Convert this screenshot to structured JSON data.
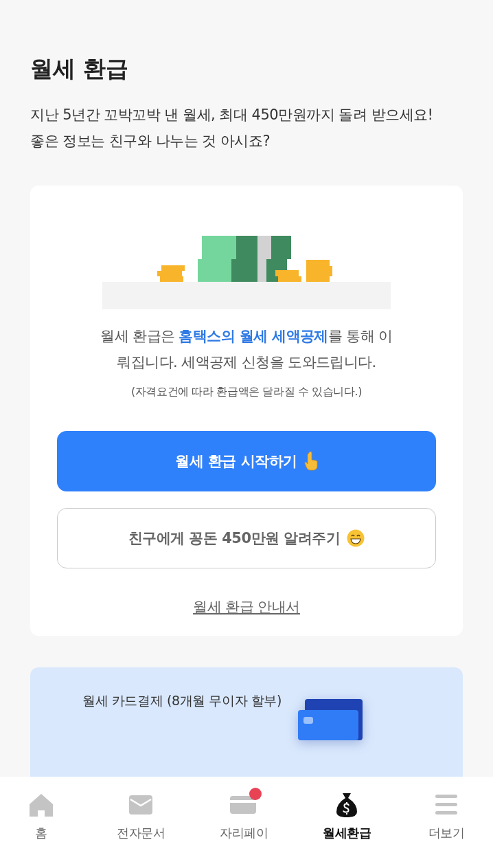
{
  "header": {
    "title": "월세 환급",
    "description": "지난 5년간 꼬박꼬박 낸 월세, 최대 450만원까지 돌려 받으세요! 좋은 정보는 친구와 나누는 것 아시죠?"
  },
  "card": {
    "description": "월세 환급은 **홈택스의 월세 세액공제**를 통해 이뤄집니다. 세액공제 신청을 도와드립니다.",
    "note": "(자격요건에 따라 환급액은 달라질 수 있습니다.)",
    "primary_button": "월세 환급 시작하기",
    "secondary_button": "친구에게 꽁돈 450만원 알려주기",
    "guide_link": "월세 환급 안내서"
  },
  "banner": {
    "title": "월세 카드결제 (8개월 무이자 할부)"
  },
  "tabs": [
    {
      "kind": "home",
      "label": "홈",
      "selected": false,
      "badge": false
    },
    {
      "kind": "mail",
      "label": "전자문서",
      "selected": false,
      "badge": false
    },
    {
      "kind": "card",
      "label": "자리페이",
      "selected": false,
      "badge": true
    },
    {
      "kind": "money",
      "label": "월세환급",
      "selected": true,
      "badge": false
    },
    {
      "kind": "menu",
      "label": "더보기",
      "selected": false,
      "badge": false
    }
  ]
}
